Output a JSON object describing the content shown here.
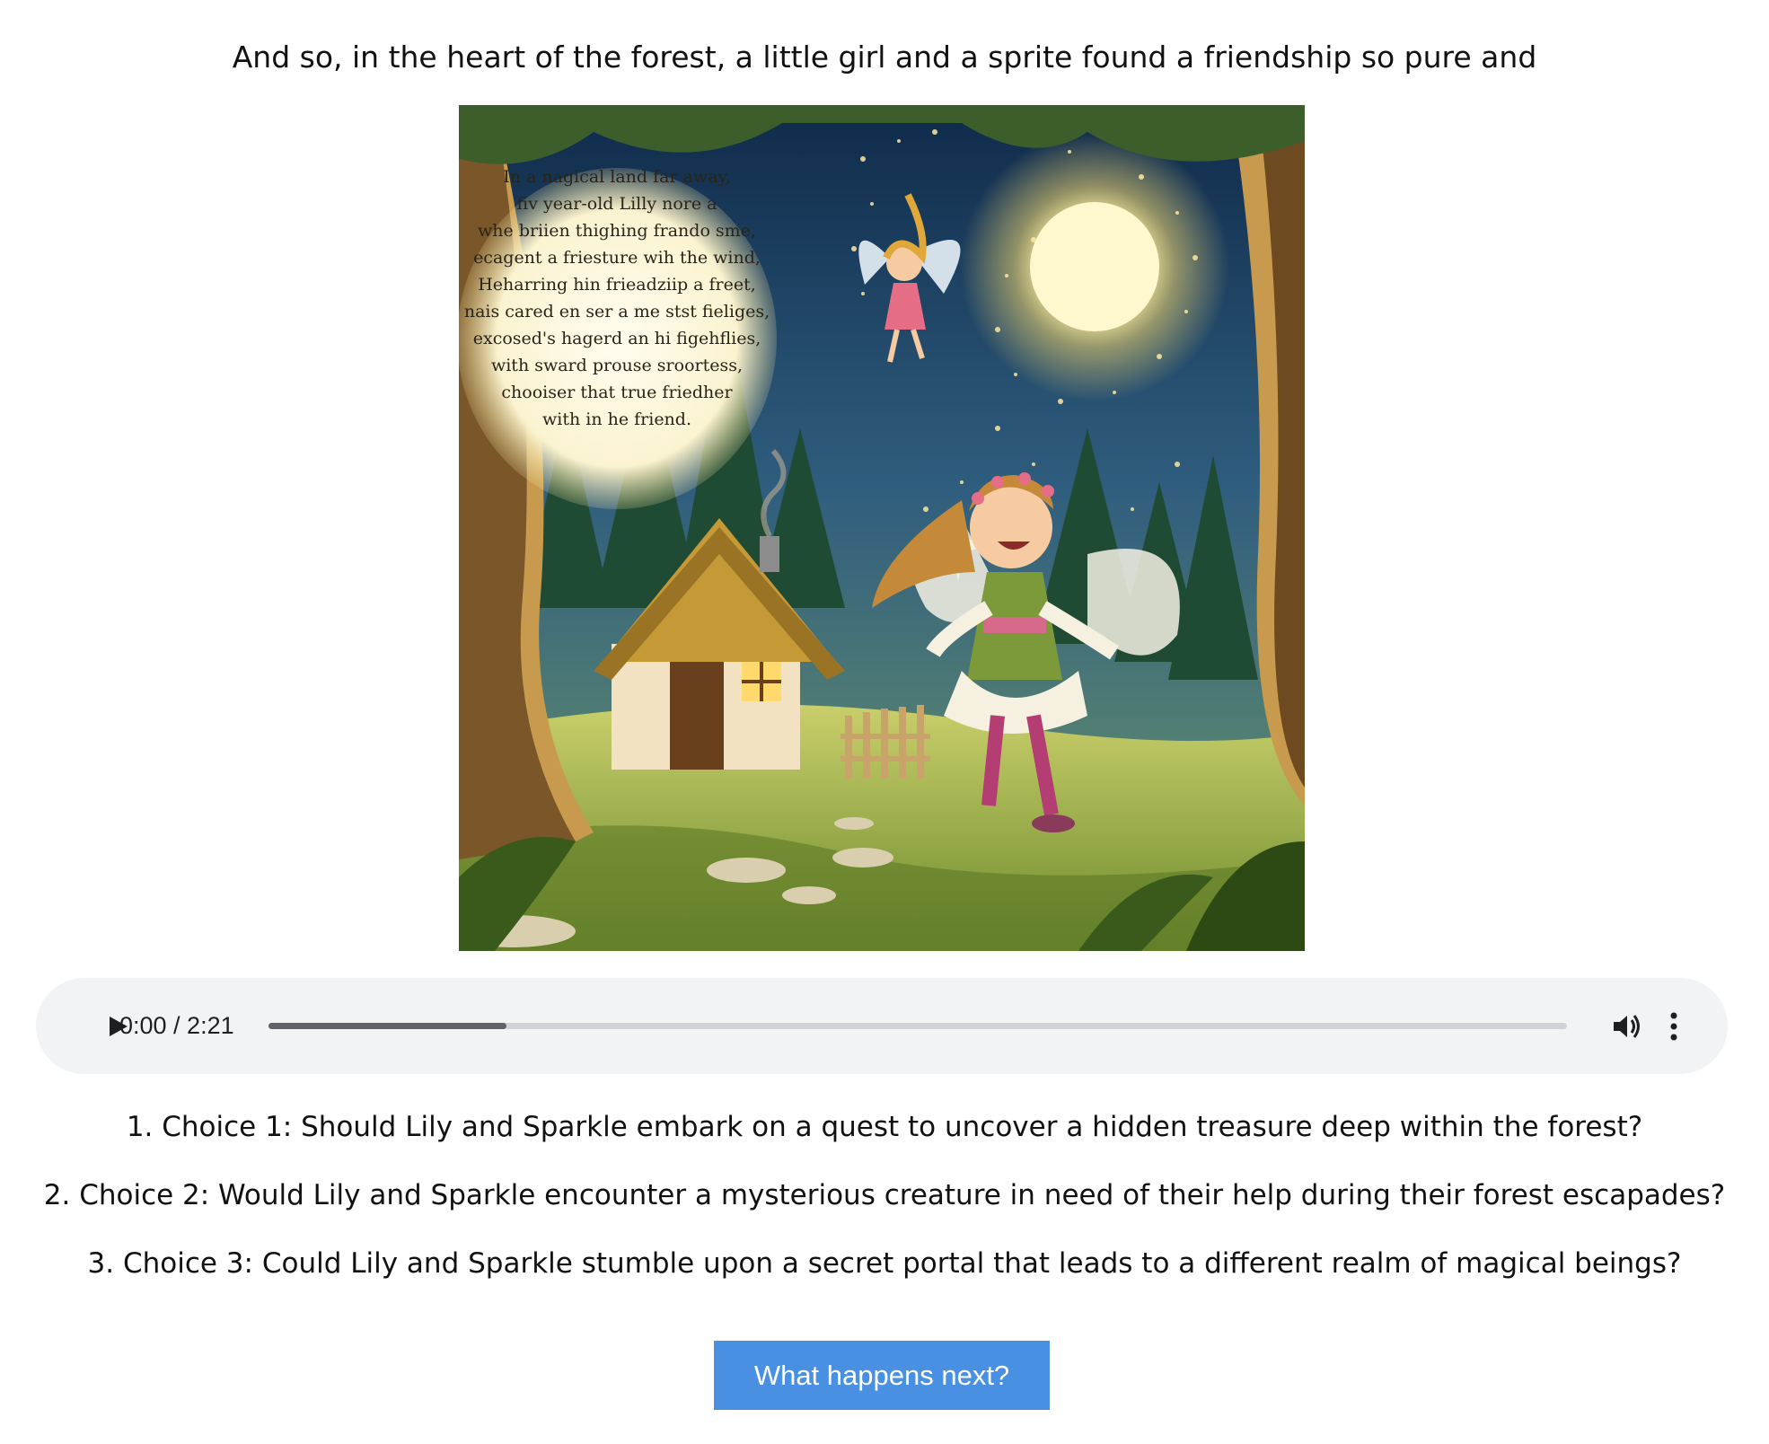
{
  "story": {
    "text": "And so, in the heart of the forest, a little girl and a sprite found a friendship so pure and"
  },
  "illustration": {
    "caption_lines": [
      "In a nagical land far away,",
      "fiv year-old Lilly nore a",
      "whe briien thighing frando sme,",
      "ecagent a friesture wih the wind,",
      "Heharring hin frieadziip a freet,",
      "nais cared en ser a me stst fieliges,",
      "excosed's hagerd an hi figehflies,",
      "with sward prouse sroortess,",
      "chooiser that true friedher",
      "with in he friend."
    ]
  },
  "audio": {
    "time": "0:00 / 2:21",
    "buffered_fraction": 0.183,
    "icons": {
      "play": "play-icon",
      "volume": "volume-icon",
      "more": "more-options-icon"
    }
  },
  "choices": [
    "1. Choice 1: Should Lily and Sparkle embark on a quest to uncover a hidden treasure deep within the forest?",
    "2. Choice 2: Would Lily and Sparkle encounter a mysterious creature in need of their help during their forest escapades?",
    "3. Choice 3: Could Lily and Sparkle stumble upon a secret portal that leads to a different realm of magical beings?"
  ],
  "next_button": {
    "label": "What happens next?"
  },
  "colors": {
    "button_bg": "#4a90e2",
    "player_bg": "#f1f3f4"
  }
}
